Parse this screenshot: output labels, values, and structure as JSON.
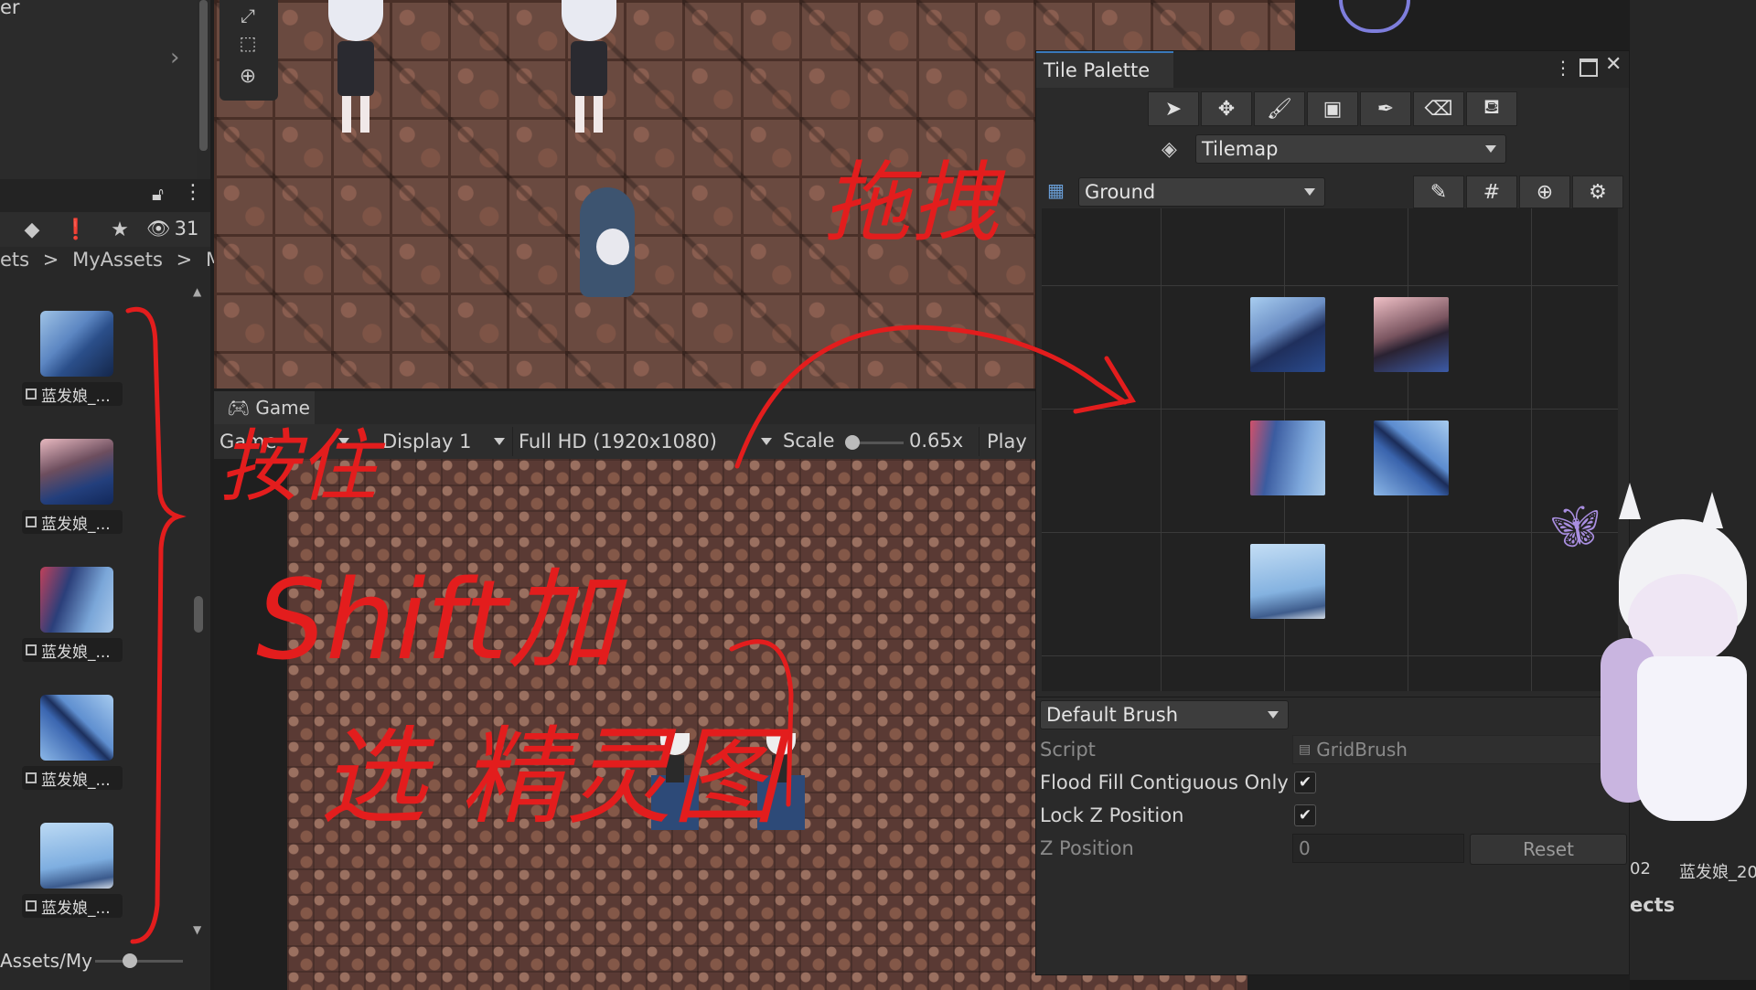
{
  "left": {
    "panel_title_fragment": "er",
    "hidden_count": "31",
    "breadcrumb": {
      "part1": "ets",
      "sep1": ">",
      "part2": "MyAssets",
      "sep2": ">",
      "part3": "Ma"
    },
    "assets": [
      {
        "label": "蓝发娘_..."
      },
      {
        "label": "蓝发娘_..."
      },
      {
        "label": "蓝发娘_..."
      },
      {
        "label": "蓝发娘_..."
      },
      {
        "label": "蓝发娘_..."
      }
    ],
    "footer_path": "Assets/My"
  },
  "game": {
    "tab_label": "Game",
    "view_select": "Game",
    "display_select": "Display 1",
    "resolution_select": "Full HD (1920x1080)",
    "scale_label": "Scale",
    "scale_value": "0.65x",
    "scale_fraction": 0.06,
    "play_label": "Play"
  },
  "palette": {
    "title": "Tile Palette",
    "tools": [
      "select-icon",
      "move-icon",
      "brush-icon",
      "box-fill-icon",
      "picker-icon",
      "eraser-icon",
      "fill-bucket-icon"
    ],
    "active_target": "Tilemap",
    "palette_name": "Ground",
    "edit_tools": [
      "pencil-icon",
      "grid-icon",
      "gizmo-icon",
      "settings-icon"
    ],
    "brush_select": "Default Brush",
    "script_label": "Script",
    "script_value": "GridBrush",
    "flood_fill_label": "Flood Fill Contiguous Only",
    "flood_fill_checked": true,
    "lock_z_label": "Lock Z Position",
    "lock_z_checked": true,
    "z_position_label": "Z Position",
    "z_position_value": "0",
    "reset_label": "Reset"
  },
  "right": {
    "asset_number_fragment": "02",
    "asset_label": "蓝发娘_20",
    "folder_fragment": "ects"
  },
  "annotations": {
    "drag_note": "拖拽",
    "hold_note": "按住",
    "shift_note": "Shift加",
    "select_note": "选 精灵图"
  },
  "colors": {
    "accent": "#3a79bb",
    "annotation_red": "#e31d1d"
  }
}
